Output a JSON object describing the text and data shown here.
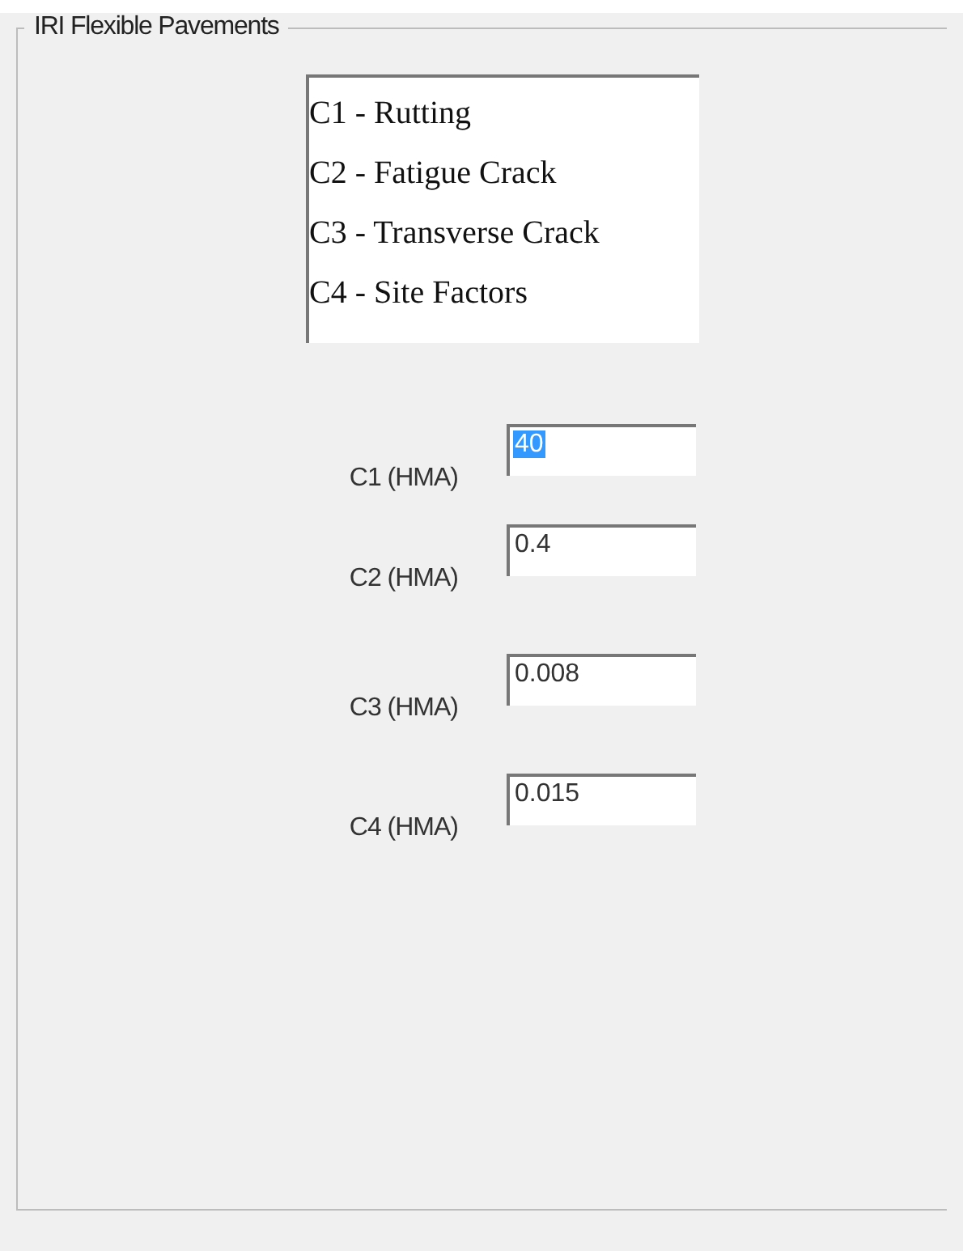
{
  "group": {
    "title": "IRI Flexible Pavements"
  },
  "list_items": [
    "C1 - Rutting",
    "C2 - Fatigue Crack",
    "C3 - Transverse Crack",
    "C4 - Site Factors"
  ],
  "fields": [
    {
      "label": "C1 (HMA)",
      "value": "40",
      "highlighted": true
    },
    {
      "label": "C2 (HMA)",
      "value": "0.4",
      "highlighted": false
    },
    {
      "label": "C3 (HMA)",
      "value": "0.008",
      "highlighted": false
    },
    {
      "label": "C4 (HMA)",
      "value": "0.015",
      "highlighted": false
    }
  ]
}
